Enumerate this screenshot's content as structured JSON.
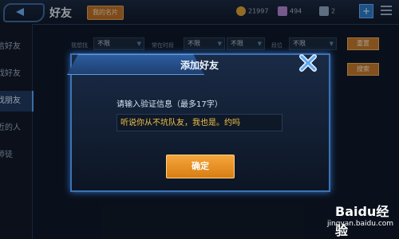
{
  "header": {
    "title": "好友",
    "name_badge": "我的名片",
    "gold": "21997",
    "gems": "494",
    "tickets": "2",
    "plus": "+"
  },
  "sidebar": {
    "items": [
      {
        "label": "信好友"
      },
      {
        "label": "戏好友"
      },
      {
        "label": "找朋友"
      },
      {
        "label": "近的人"
      },
      {
        "label": "师徒"
      }
    ]
  },
  "filters": {
    "want_label": "我想找",
    "time_label": "常在时段",
    "rank_label": "段位",
    "want_value": "不限",
    "time_value": "不限",
    "time_value2": "不限",
    "rank_value": "不限",
    "reset": "重置",
    "search": "搜索"
  },
  "modal": {
    "title": "添加好友",
    "prompt": "请输入验证信息（最多17字）",
    "message": "听说你从不坑队友，我也是。约吗",
    "confirm": "确定"
  },
  "watermark": {
    "logo": "Baidu经验",
    "sub": "jingyan.baidu.com"
  },
  "colors": {
    "accent": "#3d72b3",
    "button": "#e08a20",
    "message_text": "#f0c24a"
  }
}
